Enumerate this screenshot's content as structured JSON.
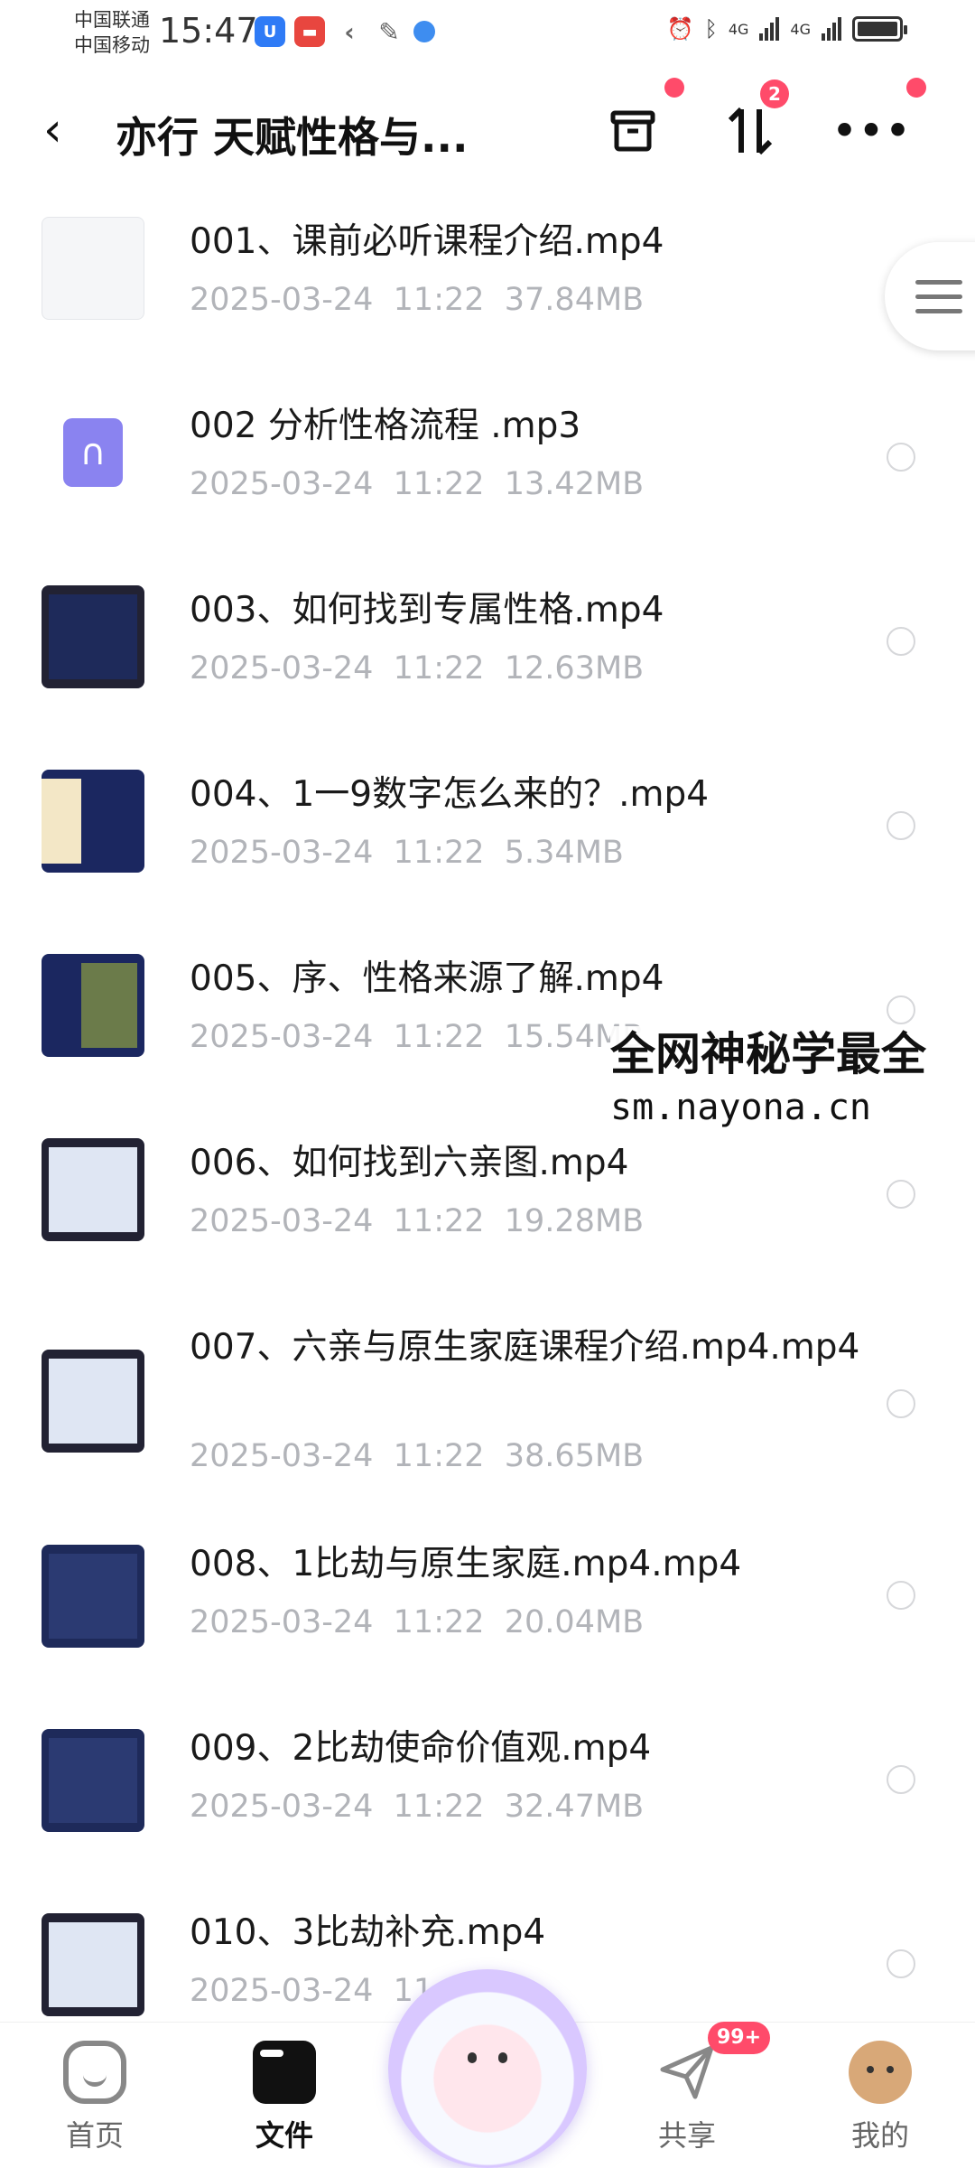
{
  "status_bar": {
    "carrier_1": "中国联通",
    "carrier_2": "中国移动",
    "time": "15:47",
    "network_1": "4G",
    "network_2": "4G"
  },
  "header": {
    "title": "亦行 天赋性格与...",
    "sort_badge": "2"
  },
  "files": [
    {
      "name": "001、课前必听课程介绍.mp4",
      "meta": "2025-03-24  11:22  37.84MB",
      "thumb": "doc"
    },
    {
      "name": "002 分析性格流程  .mp3",
      "meta": "2025-03-24  11:22  13.42MB",
      "thumb": "audio"
    },
    {
      "name": "003、如何找到专属性格.mp4",
      "meta": "2025-03-24  11:22  12.63MB",
      "thumb": "video"
    },
    {
      "name": "004、1一9数字怎么来的？.mp4",
      "meta": "2025-03-24  11:22  5.34MB",
      "thumb": "video"
    },
    {
      "name": "005、序、性格来源了解.mp4",
      "meta": "2025-03-24  11:22  15.54MB",
      "thumb": "video"
    },
    {
      "name": "006、如何找到六亲图.mp4",
      "meta": "2025-03-24  11:22  19.28MB",
      "thumb": "video"
    },
    {
      "name": "007、六亲与原生家庭课程介绍.mp4.mp4",
      "meta": "2025-03-24  11:22  38.65MB",
      "thumb": "video"
    },
    {
      "name": "008、1比劫与原生家庭.mp4.mp4",
      "meta": "2025-03-24  11:22  20.04MB",
      "thumb": "video"
    },
    {
      "name": "009、2比劫使命价值观.mp4",
      "meta": "2025-03-24  11:22  32.47MB",
      "thumb": "video"
    },
    {
      "name": "010、3比劫补充.mp4",
      "meta": "2025-03-24  11:",
      "thumb": "video"
    }
  ],
  "watermark": {
    "line1": "全网神秘学最全",
    "line2": "sm.nayona.cn"
  },
  "bottom_nav": {
    "home": "首页",
    "files": "文件",
    "share": "共享",
    "mine": "我的",
    "share_badge": "99+"
  },
  "colors": {
    "accent_red": "#ff4b6a",
    "audio_icon": "#8a83f0",
    "meta_gray": "#b2b4b9"
  }
}
